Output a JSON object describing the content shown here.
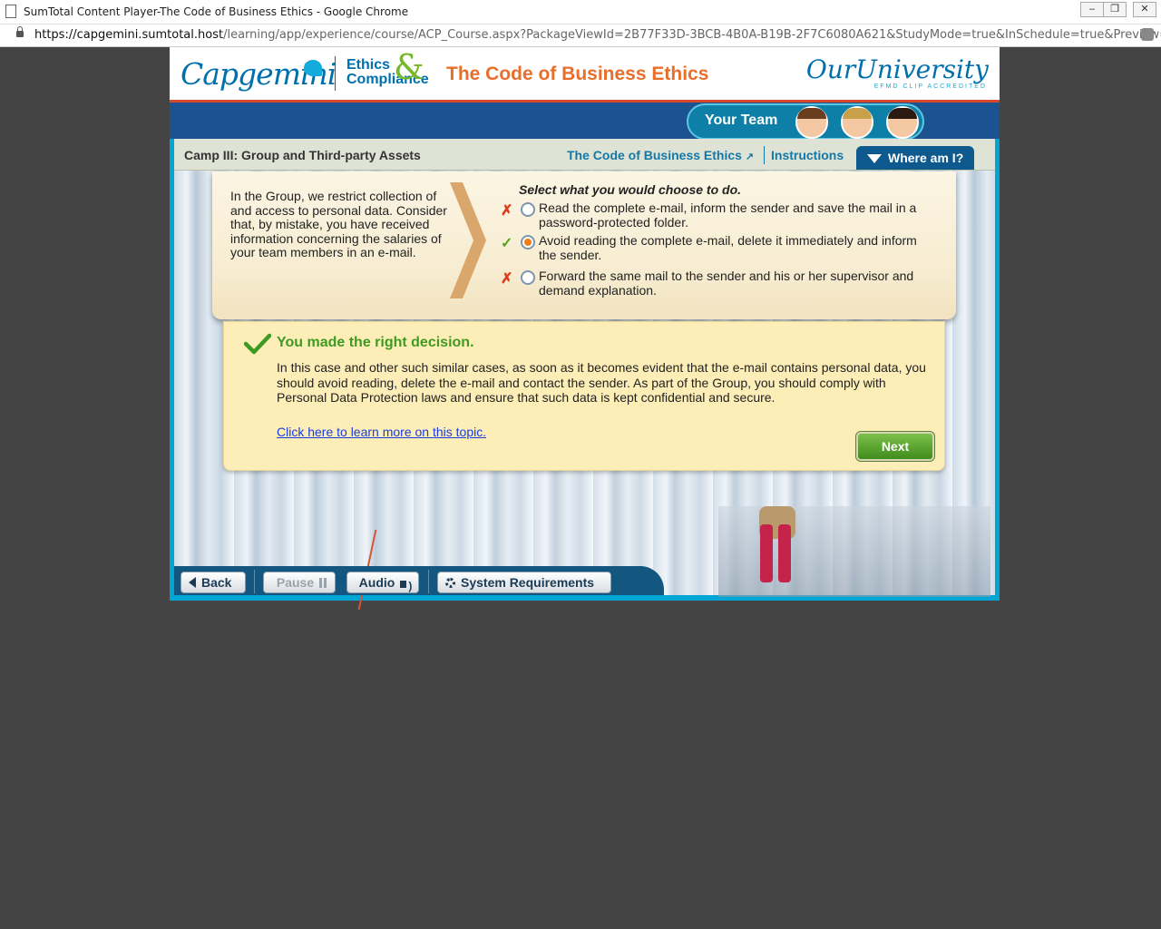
{
  "browser": {
    "window_title": "SumTotal Content Player-The Code of Business Ethics - Google Chrome",
    "url_host": "https://capgemini.sumtotal.host",
    "url_path": "/learning/app/experience/course/ACP_Course.aspx?PackageViewId=2B77F33D-3BCB-4B0A-B19B-2F7C6080A621&StudyMode=true&InSchedule=true&Preview=..."
  },
  "header": {
    "brand": "Capgemini",
    "ethics_line1": "Ethics",
    "ethics_line2": "Compliance",
    "ampersand": "&",
    "course_title": "The Code of Business Ethics",
    "university_logo": "OurUniversity",
    "university_sub": "EFMD CLIP ACCREDITED"
  },
  "team": {
    "label": "Your Team"
  },
  "toolbar": {
    "camp_title": "Camp III: Group and Third-party Assets",
    "code_link": "The Code of Business Ethics",
    "instructions": "Instructions",
    "where_am_i": "Where am I?"
  },
  "question": {
    "scenario": "In the Group, we restrict collection of and access to personal data. Consider that, by mistake, you have received information concerning the salaries of your team members in an e-mail.",
    "prompt": "Select what you would choose to do.",
    "options": [
      {
        "text": "Read the complete e-mail, inform the sender and save the mail in a password-protected folder.",
        "result": "incorrect",
        "selected": false
      },
      {
        "text": "Avoid reading the complete e-mail, delete it immediately and inform the sender.",
        "result": "correct",
        "selected": true
      },
      {
        "text": "Forward the same mail to the sender and his or her supervisor and demand explanation.",
        "result": "incorrect",
        "selected": false
      }
    ]
  },
  "feedback": {
    "heading": "You made the right decision.",
    "body": "In this case and other such similar cases, as soon as it becomes evident that the e-mail contains personal data, you should avoid reading, delete the e-mail and contact the sender. As part of the Group, you should comply with Personal Data Protection laws and ensure that such data is kept confidential and secure.",
    "link": "Click here to learn more on this topic.",
    "next": "Next"
  },
  "bottom": {
    "back": "Back",
    "pause": "Pause",
    "audio": "Audio",
    "system_requirements": "System Requirements"
  },
  "colors": {
    "accent_orange": "#e76e2b",
    "brand_blue": "#0070ad",
    "correct_green": "#3f9a24",
    "incorrect_red": "#e03b1a"
  }
}
